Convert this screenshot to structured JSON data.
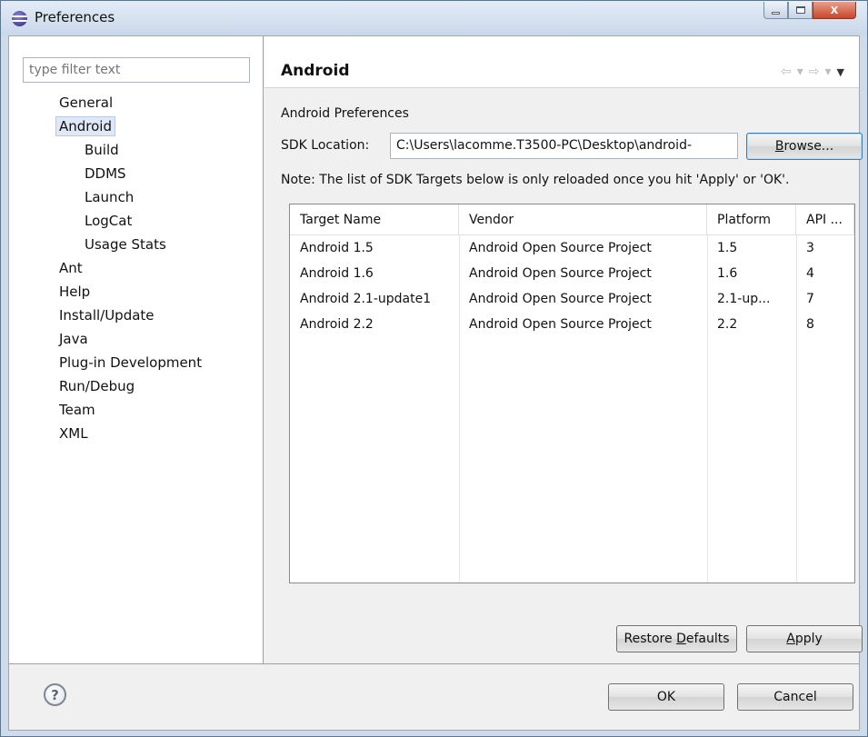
{
  "window": {
    "title": "Preferences",
    "icons": [
      "eclipse-icon"
    ],
    "caption": {
      "min": "",
      "max": "",
      "close": "X"
    }
  },
  "filter": {
    "placeholder": "type filter text"
  },
  "tree": {
    "items": [
      {
        "label": "General",
        "level": 0
      },
      {
        "label": "Android",
        "level": 0,
        "selected": true
      },
      {
        "label": "Build",
        "level": 1
      },
      {
        "label": "DDMS",
        "level": 1
      },
      {
        "label": "Launch",
        "level": 1
      },
      {
        "label": "LogCat",
        "level": 1
      },
      {
        "label": "Usage Stats",
        "level": 1
      },
      {
        "label": "Ant",
        "level": 0
      },
      {
        "label": "Help",
        "level": 0
      },
      {
        "label": "Install/Update",
        "level": 0
      },
      {
        "label": "Java",
        "level": 0
      },
      {
        "label": "Plug-in Development",
        "level": 0
      },
      {
        "label": "Run/Debug",
        "level": 0
      },
      {
        "label": "Team",
        "level": 0
      },
      {
        "label": "XML",
        "level": 0
      }
    ]
  },
  "page": {
    "title": "Android",
    "section": "Android Preferences",
    "sdk_label": "SDK Location:",
    "sdk_value": "C:\\Users\\lacomme.T3500-PC\\Desktop\\android-",
    "browse_pre": "",
    "browse_u": "B",
    "browse_post": "rowse...",
    "note": "Note: The list of SDK Targets below is only reloaded once you hit 'Apply' or 'OK'.",
    "nav": {
      "back": "⇦",
      "forward": "⇨",
      "dropdown": "▾",
      "menu": "▼"
    }
  },
  "table": {
    "headers": [
      "Target Name",
      "Vendor",
      "Platform",
      "API ..."
    ],
    "rows": [
      [
        "Android 1.5",
        "Android Open Source Project",
        "1.5",
        "3"
      ],
      [
        "Android 1.6",
        "Android Open Source Project",
        "1.6",
        "4"
      ],
      [
        "Android 2.1-update1",
        "Android Open Source Project",
        "2.1-up...",
        "7"
      ],
      [
        "Android 2.2",
        "Android Open Source Project",
        "2.2",
        "8"
      ]
    ]
  },
  "buttons": {
    "restore_pre": "Restore ",
    "restore_u": "D",
    "restore_post": "efaults",
    "apply_pre": "",
    "apply_u": "A",
    "apply_post": "pply",
    "ok": "OK",
    "cancel": "Cancel",
    "help": "?"
  }
}
